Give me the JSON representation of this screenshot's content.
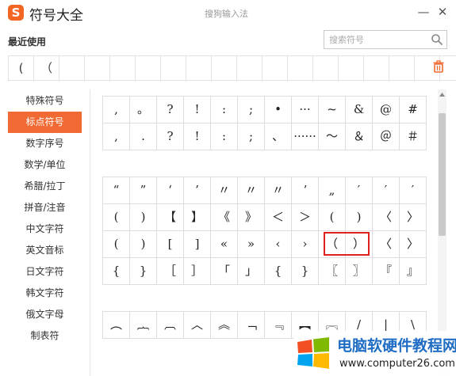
{
  "app": {
    "logo_letter": "S",
    "title": "符号大全",
    "window_title": "搜狗输入法",
    "minimize": "—",
    "close": "✕"
  },
  "recent": {
    "title": "最近使用",
    "items": [
      "(",
      "（",
      "",
      "",
      "",
      "",
      "",
      "",
      "",
      "",
      "",
      "",
      "",
      "",
      "",
      "",
      "",
      ""
    ]
  },
  "search": {
    "placeholder": "搜索符号",
    "value": ""
  },
  "sidebar": {
    "active_index": 1,
    "items": [
      {
        "label": "特殊符号"
      },
      {
        "label": "标点符号"
      },
      {
        "label": "数字序号"
      },
      {
        "label": "数学/单位"
      },
      {
        "label": "希腊/拉丁"
      },
      {
        "label": "拼音/注音"
      },
      {
        "label": "中文字符"
      },
      {
        "label": "英文音标"
      },
      {
        "label": "日文字符"
      },
      {
        "label": "韩文字符"
      },
      {
        "label": "俄文字母"
      },
      {
        "label": "制表符"
      }
    ]
  },
  "symbols": {
    "group1": [
      ",",
      "。",
      "?",
      "!",
      ":",
      ";",
      "•",
      "···",
      "~",
      "&",
      "@",
      "#",
      ",",
      ".",
      "?",
      "!",
      ":",
      ";",
      "、",
      "······",
      "～",
      "＆",
      "＠",
      "＃"
    ],
    "group2": [
      "“",
      "”",
      "‘",
      "’",
      "〃",
      "〃",
      "〃",
      "ʼ",
      "„",
      "′",
      "′",
      "′",
      "(",
      ")",
      "【",
      "】",
      "《",
      "》",
      "＜",
      "＞",
      "(",
      ")",
      "〈",
      "〉",
      "(",
      ")",
      "[",
      "]",
      "«",
      "»",
      "‹",
      "›",
      "（",
      "）",
      "〈",
      "〉",
      "{",
      "}",
      "［",
      "］",
      "「",
      "」",
      "{",
      "}",
      "〖",
      "〗",
      "『",
      "』"
    ],
    "group3": [
      "︵",
      "︷",
      "︹",
      "︿",
      "︽",
      "﹁",
      "﹃",
      "︻",
      "︗",
      "/",
      "|",
      "\\"
    ]
  },
  "watermark": {
    "title": "电脑软硬件教程网",
    "url": "www.computer26.com"
  },
  "colors": {
    "accent": "#f26a33",
    "highlight": "#e0201b",
    "watermark_blue": "#1f6dc4"
  }
}
